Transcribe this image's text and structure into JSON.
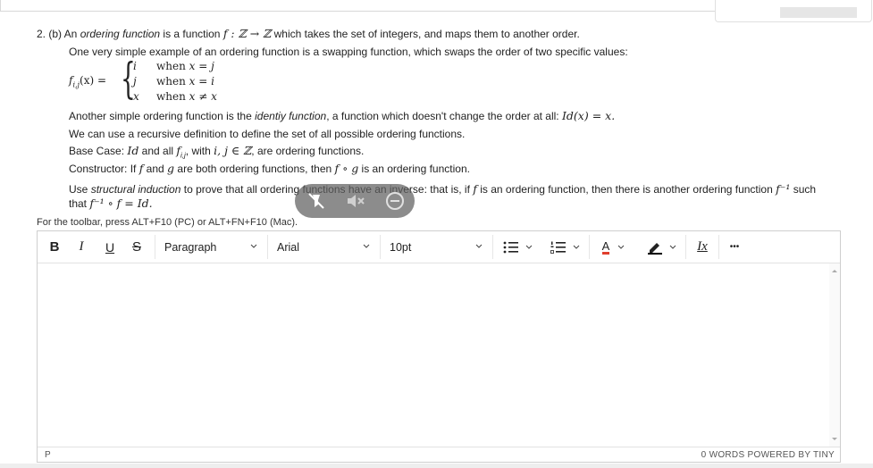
{
  "question": {
    "header_prefix": "2. (b) An ",
    "header_term": "ordering function",
    "header_mid": " is a function ",
    "header_math": "f : ℤ → ℤ",
    "header_suffix": " which takes the set of integers, and maps them to another order.",
    "swap_line": "One very simple example of an ordering function is a swapping function, which swaps the order of two specific values:",
    "piecewise": {
      "lhs": "f",
      "lhs_sub": "i,j",
      "lhs_arg": "(x) =",
      "rows": [
        {
          "value": "i",
          "when": "when",
          "cond": "x = j"
        },
        {
          "value": "j",
          "when": "when",
          "cond": "x = i"
        },
        {
          "value": "x",
          "when": "when",
          "cond": "x ≠ x"
        }
      ]
    },
    "identity_prefix": "Another simple ordering function is the ",
    "identity_term": "identiy function",
    "identity_suffix": ", a function which doesn't change the order at all: ",
    "identity_math": "Id(x) = x.",
    "recursive_line": "We can use a recursive definition to define the set of all possible ordering functions.",
    "base_prefix": "Base Case: ",
    "base_id": "Id",
    "base_mid": " and all ",
    "base_f": "f",
    "base_f_sub": "i,j",
    "base_with": ", with ",
    "base_math": "i, j ∈ ℤ",
    "base_suffix": ", are ordering functions.",
    "constructor_prefix": "Constructor: If ",
    "constructor_f": "f",
    "constructor_and": " and ",
    "constructor_g": "g",
    "constructor_mid": " are both ordering functions, then ",
    "constructor_math": "f ∘ g",
    "constructor_suffix": " is an ordering function.",
    "task_prefix": "Use ",
    "task_term": "structural induction",
    "task_mid": " to prove that all ordering functions have an inverse: that is, if ",
    "task_f": "f",
    "task_mid2": " is an ordering function, then there is another ordering function ",
    "task_finv": "f⁻¹",
    "task_suffix": " such",
    "task_line2_prefix": "that ",
    "task_line2_math": "f⁻¹ ∘ f = Id."
  },
  "toolbar_hint": "For the toolbar, press ALT+F10 (PC) or ALT+FN+F10 (Mac).",
  "toolbar": {
    "bold": "B",
    "italic": "I",
    "underline": "U",
    "strike": "S",
    "block_format": "Paragraph",
    "font_family": "Arial",
    "font_size": "10pt",
    "text_color_letter": "A",
    "clear_format": "Ix",
    "more": "•••"
  },
  "colors": {
    "text_color_swatch": "#e03e2d",
    "highlight_swatch": "#000000"
  },
  "status": {
    "path": "P",
    "words": "0 WORDS",
    "powered": "POWERED BY TINY"
  }
}
